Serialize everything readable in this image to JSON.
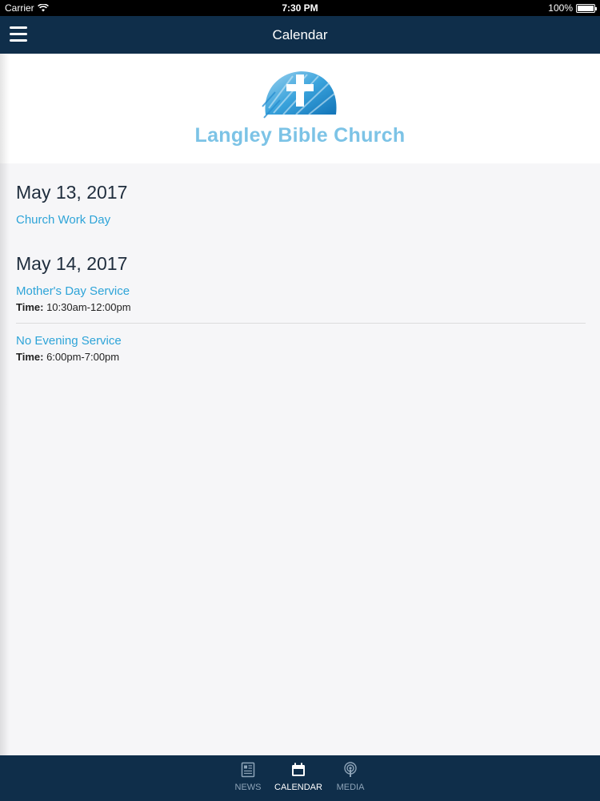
{
  "status_bar": {
    "carrier": "Carrier",
    "time": "7:30 PM",
    "battery_text": "100%",
    "battery_level": 1.0
  },
  "nav_bar": {
    "title": "Calendar"
  },
  "logo": {
    "church_name": "Langley Bible Church"
  },
  "events": [
    {
      "date": "May 13, 2017",
      "items": [
        {
          "title": "Church Work Day",
          "time_label": "",
          "time": ""
        }
      ]
    },
    {
      "date": "May 14, 2017",
      "items": [
        {
          "title": "Mother's Day Service",
          "time_label": "Time:",
          "time": "10:30am-12:00pm"
        },
        {
          "title": "No Evening Service",
          "time_label": "Time:",
          "time": "6:00pm-7:00pm"
        }
      ]
    }
  ],
  "tab_bar": {
    "tabs": [
      {
        "label": "NEWS",
        "icon": "news-icon",
        "active": false
      },
      {
        "label": "CALENDAR",
        "icon": "calendar-icon",
        "active": true
      },
      {
        "label": "MEDIA",
        "icon": "podcast-icon",
        "active": false
      }
    ]
  },
  "colors": {
    "nav_bg": "#0f2e4a",
    "link": "#2ea4d8",
    "logo_text": "#7cc3e6"
  }
}
